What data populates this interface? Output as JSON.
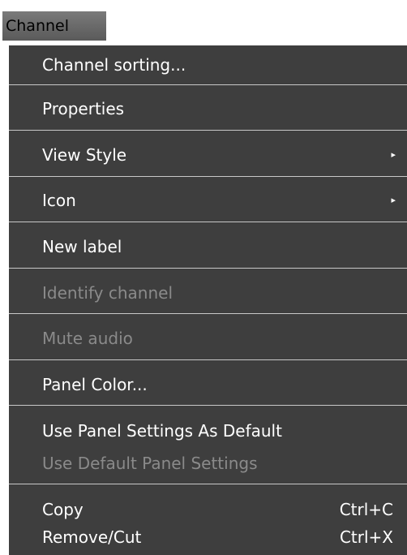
{
  "menu": {
    "title": "Channel",
    "items": [
      {
        "label": "Channel sorting..."
      },
      {
        "label": "Properties"
      },
      {
        "label": "View Style",
        "submenu_arrow": "▸"
      },
      {
        "label": "Icon",
        "submenu_arrow": "▸"
      },
      {
        "label": "New label"
      },
      {
        "label": "Identify channel",
        "disabled": true
      },
      {
        "label": "Mute audio",
        "disabled": true
      },
      {
        "label": "Panel Color..."
      },
      {
        "label": "Use Panel Settings As Default"
      },
      {
        "label": "Use Default Panel Settings",
        "disabled": true
      },
      {
        "label": "Copy",
        "shortcut": "Ctrl+C"
      },
      {
        "label": "Remove/Cut",
        "shortcut": "Ctrl+X"
      }
    ]
  },
  "colors": {
    "menu_background": "#3e3e3e",
    "enabled_text": "#ffffff",
    "disabled_text": "#8a8a8a",
    "separator": "#c8c8c8"
  }
}
